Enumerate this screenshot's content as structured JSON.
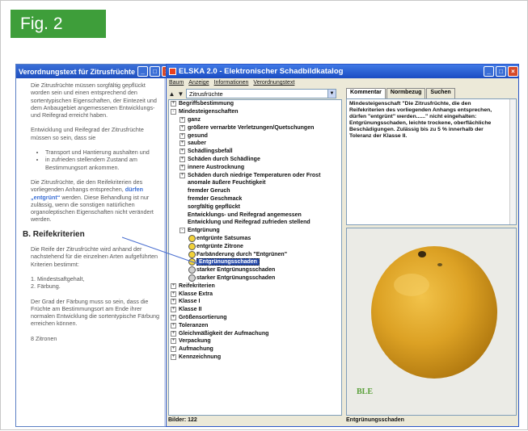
{
  "figure_label": "Fig. 2",
  "left_window": {
    "title": "Verordnungstext für Zitrusfrüchte",
    "paragraphs": [
      "Die Zitrusfrüchte müssen sorgfältig gepflückt worden sein und einen entsprechend den sortentypischen Eigenschaften, der Eintezeit und dem Anbaugebiet angemessenen Entwicklungs- und Reifegrad erreicht haben.",
      "Entwicklung und Reifegrad der Zitrusfrüchte müssen so sein, dass sie"
    ],
    "bullets": [
      "Transport und Hantierung aushalten und",
      "in zufrieden stellendem Zustand am Bestimmungsort ankommen."
    ],
    "para3_before": "Die Zitrusfrüchte, die den Reifekriterien des vorliegenden Anhangs entsprechen, ",
    "para3_highlight": "dürfen „entgrünt“",
    "para3_after": " werden. Diese Behandlung ist nur zulässig, wenn die sonstigen natürlichen organoleptischen Eigenschaften nicht verändert werden.",
    "heading": "B. Reifekriterien",
    "para4": "Die Reife der Zitrusfrüchte wird anhand der nachstehend für die einzelnen Arten aufgeführten Kriterien bestimmt:",
    "numbered": [
      "1. Mindestsaftgehalt,",
      "2. Färbung."
    ],
    "para5": "Der Grad der Färbung muss so sein, dass die Früchte am Bestimmungsort am Ende ihrer normalen Entwicklung die sortentypische Färbung erreichen können.",
    "para6": "8 Zitronen"
  },
  "main_window": {
    "title": "ELSKA 2.0 - Elektronischer Schadbildkatalog",
    "menu": [
      "Baum",
      "Anzeige",
      "Informationen",
      "Verordnungstext"
    ],
    "combo_value": "Zitrusfrüchte",
    "tabs": [
      "Kommentar",
      "Normbezug",
      "Suchen"
    ],
    "comment_text": "Mindesteigenschaft \"Die Zitrusfrüchte, die den Reifekriterien des vorliegenden Anhangs entsprechen, dürfen \"entgrünt\" werden......\" nicht eingehalten: Entgrünungsschaden, leichte trockene, oberflächliche Beschädigungen. Zulässig bis zu 5 % innerhalb der Toleranz der Klasse II.",
    "tree": [
      {
        "label": "Begriffsbestimmung",
        "level": 0,
        "toggle": "+"
      },
      {
        "label": "Mindesteigenschaften",
        "level": 0,
        "toggle": "-"
      },
      {
        "label": "ganz",
        "level": 1,
        "toggle": "+"
      },
      {
        "label": "größere vernarbte Verletzungen/Quetschungen",
        "level": 1,
        "toggle": "+"
      },
      {
        "label": "gesund",
        "level": 1,
        "toggle": "+"
      },
      {
        "label": "sauber",
        "level": 1,
        "toggle": "+"
      },
      {
        "label": "Schädlingsbefall",
        "level": 1,
        "toggle": "+"
      },
      {
        "label": "Schäden durch Schädlinge",
        "level": 1,
        "toggle": "+"
      },
      {
        "label": "innere Austrocknung",
        "level": 1,
        "toggle": "+"
      },
      {
        "label": "Schäden durch niedrige Temperaturen oder Frost",
        "level": 1,
        "toggle": "+"
      },
      {
        "label": "anomale äußere Feuchtigkeit",
        "level": 1,
        "toggle": ""
      },
      {
        "label": "fremder Geruch",
        "level": 1,
        "toggle": ""
      },
      {
        "label": "fremder Geschmack",
        "level": 1,
        "toggle": ""
      },
      {
        "label": "sorgfältig gepflückt",
        "level": 1,
        "toggle": ""
      },
      {
        "label": "Entwicklungs- und Reifegrad angemessen",
        "level": 1,
        "toggle": ""
      },
      {
        "label": "Entwicklung und Reifegrad zufrieden stellend",
        "level": 1,
        "toggle": ""
      },
      {
        "label": "Entgrünung",
        "level": 1,
        "toggle": "-"
      },
      {
        "label": "entgrünte Satsumas",
        "level": 2,
        "icon": "smiley",
        "toggle": ""
      },
      {
        "label": "entgrünte Zitrone",
        "level": 2,
        "icon": "smiley",
        "toggle": ""
      },
      {
        "label": "Farbänderung durch \"Entgrünen\"",
        "level": 2,
        "icon": "smiley",
        "toggle": ""
      },
      {
        "label": "Entgrünungsschaden",
        "level": 2,
        "icon": "smiley",
        "selected": true,
        "toggle": ""
      },
      {
        "label": "starker Entgrünungsschaden",
        "level": 2,
        "icon": "smiley-grey",
        "toggle": ""
      },
      {
        "label": "starker Entgrünungsschaden",
        "level": 2,
        "icon": "smiley-grey",
        "toggle": ""
      },
      {
        "label": "Reifekriterien",
        "level": 0,
        "toggle": "+"
      },
      {
        "label": "Klasse Extra",
        "level": 0,
        "toggle": "+"
      },
      {
        "label": "Klasse I",
        "level": 0,
        "toggle": "+"
      },
      {
        "label": "Klasse II",
        "level": 0,
        "toggle": "+"
      },
      {
        "label": "Größensortierung",
        "level": 0,
        "toggle": "+"
      },
      {
        "label": "Toleranzen",
        "level": 0,
        "toggle": "+"
      },
      {
        "label": "Gleichmäßigkeit der Aufmachung",
        "level": 0,
        "toggle": "+"
      },
      {
        "label": "Verpackung",
        "level": 0,
        "toggle": "+"
      },
      {
        "label": "Aufmachung",
        "level": 0,
        "toggle": "+"
      },
      {
        "label": "Kennzeichnung",
        "level": 0,
        "toggle": "+"
      }
    ],
    "photo_watermark": "BLE",
    "status_left": "Bilder: 122",
    "status_right": "Entgrünungsschaden"
  },
  "colors": {
    "badge": "#3e9e3a",
    "titlebar": "#2a5bd0",
    "selection": "#2b4fb0",
    "highlight_link": "#3b6fd4"
  }
}
